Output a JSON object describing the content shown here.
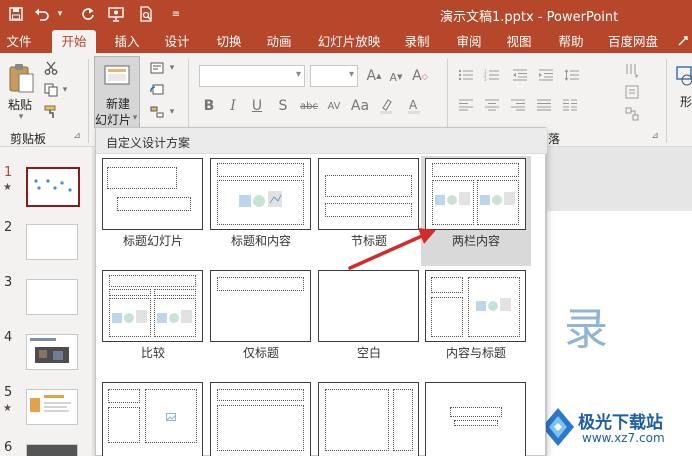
{
  "titlebar": {
    "title": "演示文稿1.pptx  -  PowerPoint",
    "bg_color": "#b7472a",
    "quick_access": [
      "save-icon",
      "undo-icon",
      "redo-icon",
      "present-icon",
      "print-preview-icon",
      "customize-icon"
    ]
  },
  "tabs": [
    "文件",
    "开始",
    "插入",
    "设计",
    "切换",
    "动画",
    "幻灯片放映",
    "录制",
    "审阅",
    "视图",
    "帮助",
    "百度网盘"
  ],
  "active_tab": "开始",
  "ribbon": {
    "paste_label": "粘贴",
    "clipboard_group": "剪贴板",
    "new_slide_line1": "新建",
    "new_slide_line2": "幻灯片",
    "paragraph_group_partial": "落",
    "drawing_partial": "形"
  },
  "gallery": {
    "header": "自定义设计方案",
    "layouts": [
      "标题幻灯片",
      "标题和内容",
      "节标题",
      "两栏内容",
      "比较",
      "仅标题",
      "空白",
      "内容与标题"
    ],
    "selected": "两栏内容",
    "arrow_color": "#d42a2a"
  },
  "slides_pane": {
    "numbers": [
      "1",
      "2",
      "3",
      "4",
      "5",
      "6"
    ],
    "star": "★",
    "selected": "1",
    "selected_border": "#8b1a1a"
  },
  "canvas": {
    "glyph": "录"
  },
  "watermark": {
    "text": "极光下载站",
    "url": "www.xz7.com"
  }
}
